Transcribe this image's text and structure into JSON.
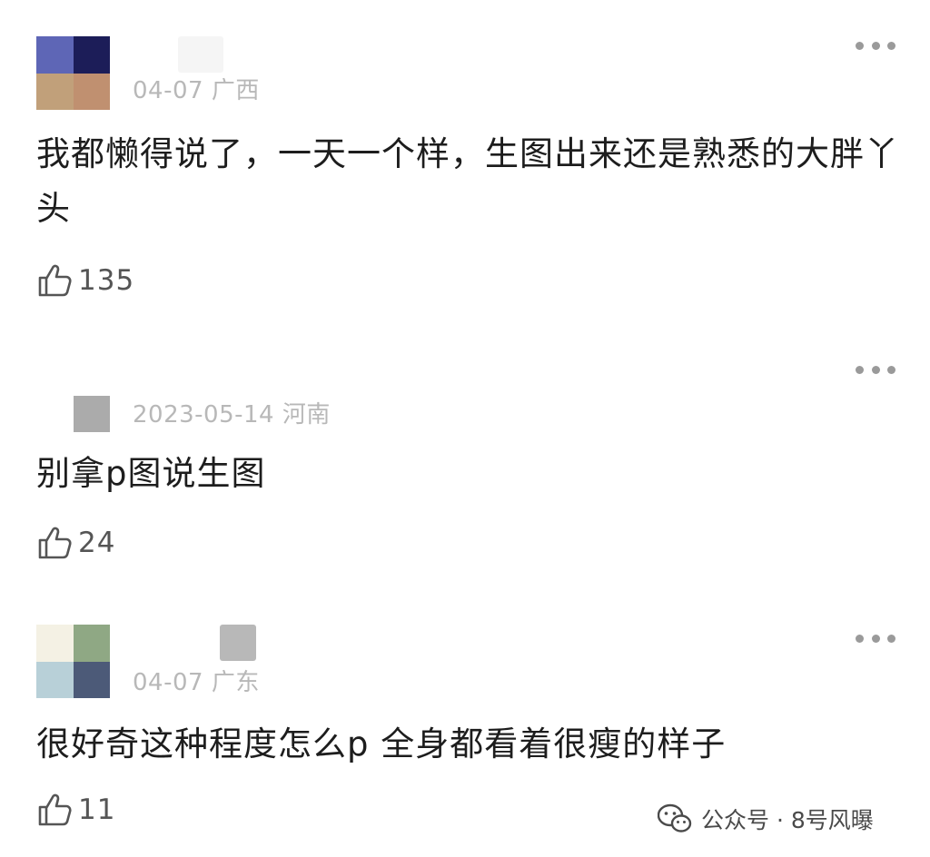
{
  "comments": [
    {
      "date": "04-07",
      "location": "广西",
      "text": "我都懒得说了，一天一个样，生图出来还是熟悉的大胖丫头",
      "likes": "135",
      "avatar_colors": [
        "#5e66b6",
        "#1c1d58",
        "#c1a07a",
        "#c09070"
      ]
    },
    {
      "date": "2023-05-14",
      "location": "河南",
      "text": "别拿p图说生图",
      "likes": "24",
      "avatar_colors": [
        "#ababab"
      ]
    },
    {
      "date": "04-07",
      "location": "广东",
      "text": "很好奇这种程度怎么p 全身都看着很瘦的样子",
      "likes": "11",
      "avatar_colors": [
        "#f4f1e4",
        "#8fa884",
        "#b8d0d8",
        "#4c5a78"
      ]
    }
  ],
  "watermark": {
    "text": "公众号 · 8号风曝",
    "icon": "wechat-icon"
  },
  "icons": {
    "more": "more-dots-icon",
    "like": "thumbs-up-icon"
  }
}
